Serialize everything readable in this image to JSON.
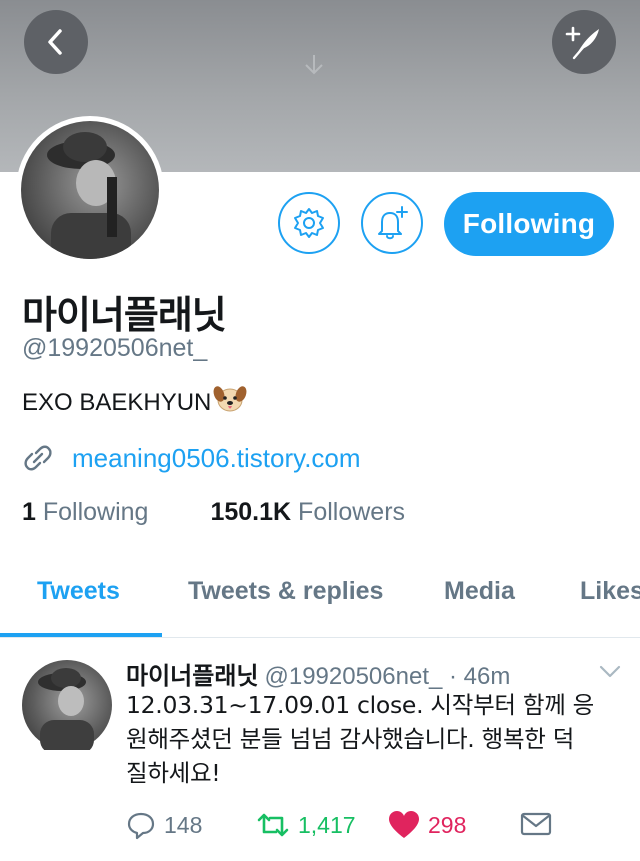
{
  "profile": {
    "display_name": "마이너플래닛",
    "handle": "@19920506net_",
    "bio_text": "EXO BAEKHYUN",
    "bio_emoji": "dog-face-emoji",
    "website": "meaning0506.tistory.com",
    "following_count": "1",
    "following_label": "Following",
    "followers_count": "150.1K",
    "followers_label": "Followers"
  },
  "buttons": {
    "following": "Following"
  },
  "icons": {
    "back": "chevron-left-icon",
    "compose": "compose-feather-icon",
    "settings": "gear-icon",
    "notify": "bell-plus-icon",
    "link": "link-icon"
  },
  "tabs": [
    {
      "label": "Tweets",
      "active": true
    },
    {
      "label": "Tweets & replies",
      "active": false
    },
    {
      "label": "Media",
      "active": false
    },
    {
      "label": "Likes",
      "active": false
    }
  ],
  "tweet": {
    "name": "마이너플래닛",
    "handle": "@19920506net_",
    "time": "· 46m",
    "lines": [
      "12.03.31~17.09.01 close. 시작부터 함께 응",
      "원해주셨던 분들 넘넘 감사했습니다. 행복한 덕",
      "질하세요!"
    ],
    "replies": "148",
    "retweets": "1,417",
    "likes": "298"
  },
  "colors": {
    "accent": "#1da1f2",
    "retweet": "#17bf63",
    "like": "#e0245e",
    "muted": "#657786"
  }
}
